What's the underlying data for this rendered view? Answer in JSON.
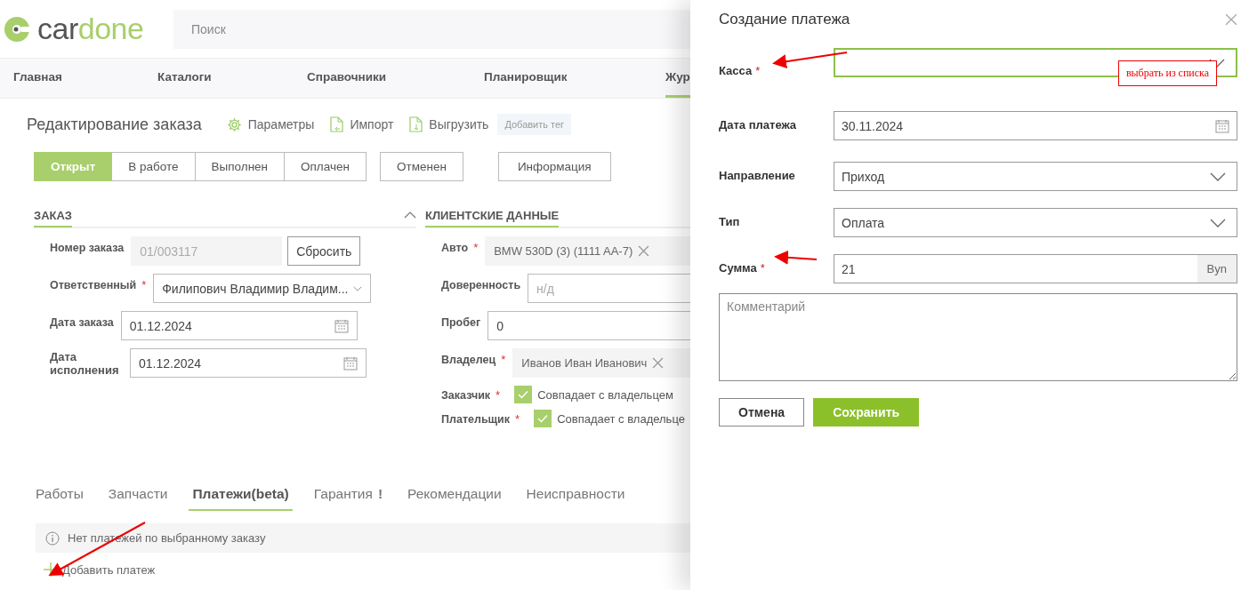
{
  "logo": {
    "dark": "car",
    "light": "done"
  },
  "search": {
    "placeholder": "Поиск"
  },
  "nav": [
    {
      "label": "Главная",
      "selected": false
    },
    {
      "label": "Каталоги",
      "selected": false
    },
    {
      "label": "Справочники",
      "selected": false
    },
    {
      "label": "Планировщик",
      "selected": false
    },
    {
      "label": "Жур",
      "selected": true
    }
  ],
  "page": {
    "title": "Редактирование заказа",
    "actions": [
      {
        "kind": "gear",
        "label": "Параметры"
      },
      {
        "kind": "import",
        "label": "Импорт"
      },
      {
        "kind": "export",
        "label": "Выгрузить"
      }
    ],
    "tag_button": "Добавить тег"
  },
  "statuses": [
    {
      "label": "Открыт",
      "selected": true
    },
    {
      "label": "В работе",
      "selected": false
    },
    {
      "label": "Выполнен",
      "selected": false
    },
    {
      "label": "Оплачен",
      "selected": false
    },
    {
      "label": "Отменен",
      "selected": false
    }
  ],
  "info_button": "Информация",
  "order": {
    "title": "ЗАКАЗ",
    "fields": [
      {
        "kind": "readonly",
        "label": "Номер заказа",
        "value": "01/003117",
        "button": "Сбросить"
      },
      {
        "kind": "select",
        "label": "Ответственный",
        "required_mark": "*",
        "value": "Филипович Владимир Владим..."
      },
      {
        "kind": "date",
        "label": "Дата заказа",
        "value": "01.12.2024"
      },
      {
        "kind": "date",
        "label": "Дата исполнения",
        "value": "01.12.2024"
      }
    ]
  },
  "client": {
    "title": "КЛИЕНТСКИЕ ДАННЫЕ",
    "expanded": true,
    "fields": [
      {
        "kind": "chip",
        "label": "Авто",
        "required_mark": "*",
        "value": "BMW 530D (3) (1111 AA-7)"
      },
      {
        "kind": "input",
        "label": "Доверенность",
        "placeholder": "н/д"
      },
      {
        "kind": "input",
        "label": "Пробег",
        "value": "0"
      },
      {
        "kind": "chip",
        "label": "Владелец",
        "required_mark": "*",
        "value": "Иванов Иван Иванович"
      },
      {
        "kind": "checkbox",
        "label": "Заказчик",
        "required_mark": "*",
        "checked": true,
        "text": "Совпадает с владельцем"
      },
      {
        "kind": "checkbox",
        "label": "Плательщик",
        "required_mark": "*",
        "checked": true,
        "text": "Совпадает с владельце"
      }
    ]
  },
  "tabs": [
    {
      "label": "Работы",
      "selected": false
    },
    {
      "label": "Запчасти",
      "selected": false
    },
    {
      "label": "Платежи(beta)",
      "selected": true
    },
    {
      "label": "Гарантия",
      "selected": false,
      "badge": "!"
    },
    {
      "label": "Рекомендации",
      "selected": false
    },
    {
      "label": "Неисправности",
      "selected": false
    }
  ],
  "empty_message": "Нет платежей по выбранному заказу",
  "add_button": "Добавить платеж",
  "dialog": {
    "title": "Создание платежа",
    "fields": [
      {
        "kind": "select",
        "label": "Касса",
        "required_mark": "*",
        "focused": true
      },
      {
        "kind": "date",
        "label": "Дата платежа",
        "focused": false,
        "value": "30.11.2024"
      },
      {
        "kind": "select",
        "label": "Направление",
        "focused": false,
        "value": "Приход"
      },
      {
        "kind": "select",
        "label": "Тип",
        "focused": false,
        "value": "Оплата"
      },
      {
        "kind": "money",
        "label": "Сумма",
        "required_mark": "*",
        "focused": false,
        "value": "21",
        "suffix": "Byn"
      }
    ],
    "comment": {
      "placeholder": "Комментарий"
    },
    "buttons": [
      {
        "kind": "secondary",
        "label": "Отмена"
      },
      {
        "kind": "primary",
        "label": "Сохранить"
      }
    ]
  },
  "annotation": {
    "note": "выбрать из списка"
  }
}
